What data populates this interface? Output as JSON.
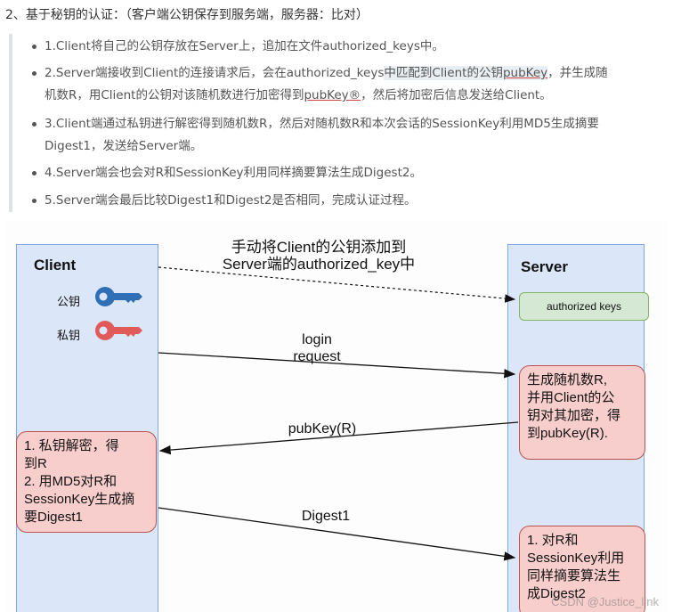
{
  "heading": "2、基于秘钥的认证：（客户端公钥保存到服务端，服务器：比对）",
  "steps": {
    "s1": "1.Client将自己的公钥存放在Server上，追加在文件authorized_keys中。",
    "s2_a": "2.Server端接收到Client的连接请求后，会在authorized_keys",
    "s2_b": "中匹配到Client的公钥",
    "s2_c": "pubKey",
    "s2_d": "，并生成随",
    "s2_e": "机数R，用Client的公钥对该随机数进行加密得到",
    "s2_f": "pubKey®",
    "s2_g": "，然后将加密后信息发送给Client。",
    "s3_a": "3.Client端通过私钥进行解密得到随机数R，然后对随机数R和本次会话的SessionKey利用MD5生成摘要",
    "s3_b": "Digest1，发送给Server端。",
    "s4": "4.Server端会也会对R和SessionKey利用同样摘要算法生成Digest2。",
    "s5": "5.Server端会最后比较Digest1和Digest2是否相同，完成认证过程。"
  },
  "diagram": {
    "client_title": "Client",
    "server_title": "Server",
    "public_key_label": "公钥",
    "private_key_label": "私钥",
    "public_key_color": "#2f6fb5",
    "private_key_color": "#e05a5a",
    "top_note_1": "手动将Client的公钥添加到",
    "top_note_2": "Server端的authorized_key中",
    "authorized_keys": "authorized keys",
    "login_1": "login",
    "login_2": "request",
    "server_box_1": "生成随机数R,\n并用Client的公\n钥对其加密，得\n到pubKey(R).",
    "pubkey_label": "pubKey(R)",
    "client_box": "1. 私钥解密，得\n到R\n2. 用MD5对R和\nSessionKey生成摘\n要Digest1",
    "digest_label": "Digest1",
    "server_box_2": "1. 对R和\nSessionKey利用\n同样摘要算法生\n成Digest2",
    "watermark": "CSDN @Justice_link"
  }
}
